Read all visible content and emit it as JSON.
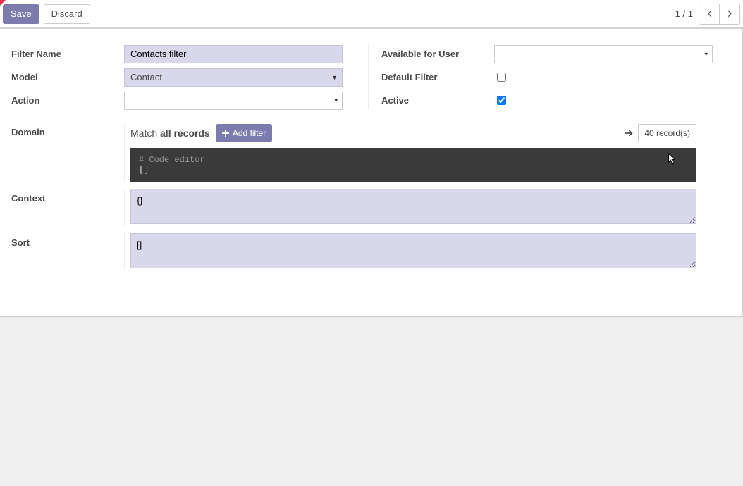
{
  "toolbar": {
    "save_label": "Save",
    "discard_label": "Discard"
  },
  "pager": {
    "text": "1 / 1"
  },
  "labels": {
    "filter_name": "Filter Name",
    "model": "Model",
    "action": "Action",
    "available_user": "Available for User",
    "default_filter": "Default Filter",
    "active": "Active",
    "domain": "Domain",
    "context": "Context",
    "sort": "Sort"
  },
  "form": {
    "filter_name_value": "Contacts filter",
    "model_value": "Contact",
    "action_value": "",
    "available_user_value": "",
    "default_filter_checked": false,
    "active_checked": true,
    "context_value": "{}",
    "sort_value": "[]"
  },
  "domain": {
    "match_prefix": "Match ",
    "match_bold": "all records",
    "add_filter_label": " Add filter",
    "records_label": "40 record(s)",
    "code_comment": "# Code editor",
    "code_value": "[]"
  }
}
